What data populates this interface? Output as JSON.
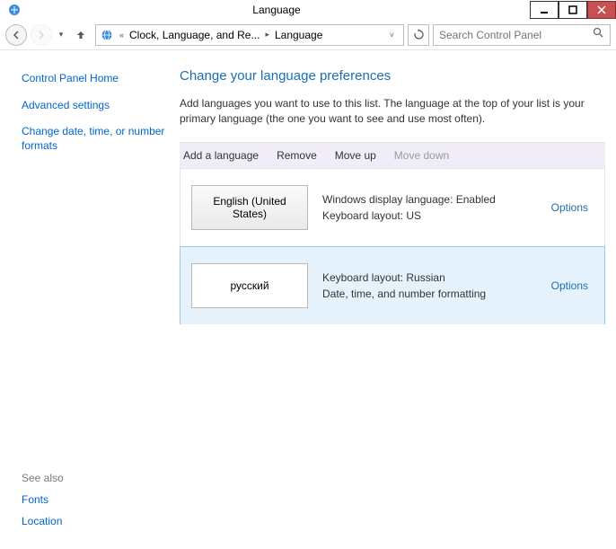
{
  "window": {
    "title": "Language"
  },
  "nav": {
    "crumb1": "Clock, Language, and Re...",
    "crumb2": "Language",
    "search_placeholder": "Search Control Panel"
  },
  "sidebar": {
    "home": "Control Panel Home",
    "adv": "Advanced settings",
    "datetime": "Change date, time, or number formats",
    "seealso": "See also",
    "fonts": "Fonts",
    "location": "Location"
  },
  "main": {
    "heading": "Change your language preferences",
    "intro": "Add languages you want to use to this list. The language at the top of your list is your primary language (the one you want to see and use most often).",
    "toolbar": {
      "add": "Add a language",
      "remove": "Remove",
      "moveup": "Move up",
      "movedown": "Move down"
    },
    "langs": [
      {
        "name": "English (United States)",
        "details": "Windows display language: Enabled\nKeyboard layout: US",
        "options": "Options",
        "selected": false
      },
      {
        "name": "русский",
        "details": "Keyboard layout: Russian\nDate, time, and number formatting",
        "options": "Options",
        "selected": true
      }
    ]
  }
}
